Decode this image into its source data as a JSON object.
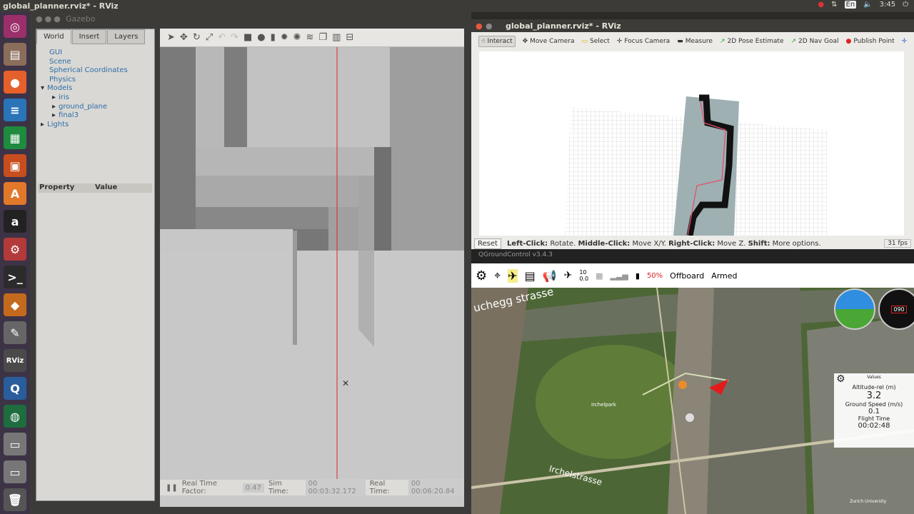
{
  "topbar": {
    "title": "global_planner.rviz* - RViz",
    "lang": "En",
    "time": "3:45"
  },
  "launcher": {
    "items": [
      {
        "icon": "ubuntu-dash-icon",
        "color": "#9b2f6a",
        "glyph": "◎"
      },
      {
        "icon": "files-icon",
        "color": "#8a6d5a",
        "glyph": "▤"
      },
      {
        "icon": "firefox-icon",
        "color": "#e5602a",
        "glyph": "●"
      },
      {
        "icon": "writer-icon",
        "color": "#2a74b8",
        "glyph": "≡"
      },
      {
        "icon": "calc-icon",
        "color": "#1e8b3e",
        "glyph": "▦"
      },
      {
        "icon": "impress-icon",
        "color": "#c74e1e",
        "glyph": "▣"
      },
      {
        "icon": "software-center-icon",
        "color": "#e2782a",
        "glyph": "A"
      },
      {
        "icon": "amazon-icon",
        "color": "#222",
        "glyph": "a"
      },
      {
        "icon": "settings-icon",
        "color": "#b33a3a",
        "glyph": "⚙"
      },
      {
        "icon": "terminal-icon",
        "color": "#2b2b2b",
        "glyph": ">_"
      },
      {
        "icon": "gazebo-icon",
        "color": "#c46a1e",
        "glyph": "◆"
      },
      {
        "icon": "text-editor-icon",
        "color": "#666",
        "glyph": "✎"
      },
      {
        "icon": "rviz-icon",
        "color": "#4a4a4a",
        "glyph": "RViz"
      },
      {
        "icon": "qgroundcontrol-icon",
        "color": "#2a5d9b",
        "glyph": "Q"
      },
      {
        "icon": "globe-icon",
        "color": "#1e6d3e",
        "glyph": "◍"
      },
      {
        "icon": "drive-icon",
        "color": "#777",
        "glyph": "▭"
      },
      {
        "icon": "drive-icon",
        "color": "#777",
        "glyph": "▭"
      },
      {
        "icon": "trash-icon",
        "color": "#555",
        "glyph": "🗑"
      }
    ]
  },
  "gazebo": {
    "window_title": "Gazebo",
    "tabs": [
      "World",
      "Insert",
      "Layers"
    ],
    "tree": [
      "GUI",
      "Scene",
      "Spherical Coordinates",
      "Physics",
      "Models",
      "iris",
      "ground_plane",
      "final3",
      "Lights"
    ],
    "property_header": "Property",
    "value_header": "Value",
    "status": {
      "rtf_label": "Real Time Factor:",
      "rtf": "0.47",
      "sim_label": "Sim Time:",
      "sim": "00 00:03:32.172",
      "real_label": "Real Time:",
      "real": "00 00:06:20.84"
    }
  },
  "rviz": {
    "window_title": "global_planner.rviz* - RViz",
    "tools": [
      "Interact",
      "Move Camera",
      "Select",
      "Focus Camera",
      "Measure",
      "2D Pose Estimate",
      "2D Nav Goal",
      "Publish Point"
    ],
    "status_btn": "Reset",
    "hint": [
      "Left-Click:",
      " Rotate. ",
      "Middle-Click:",
      " Move X/Y. ",
      "Right-Click:",
      " Move Z. ",
      "Shift:",
      " More options."
    ],
    "fps": "31 fps"
  },
  "qgc": {
    "version": "QGroundControl v3.4.3",
    "gps_count": "10",
    "gps_hdop": "0.0",
    "battery": "50%",
    "mode": "Offboard",
    "armed": "Armed",
    "map_labels": [
      "uchegg strasse",
      "Irchelpark",
      "Irchelstrasse",
      "Zurich University"
    ],
    "values_title": "Values",
    "altitude_label": "Altitude-rel (m)",
    "altitude": "3.2",
    "speed_label": "Ground Speed (m/s)",
    "speed": "0.1",
    "flight_label": "Flight Time",
    "flight": "00:02:48",
    "compass_heading": "090"
  }
}
